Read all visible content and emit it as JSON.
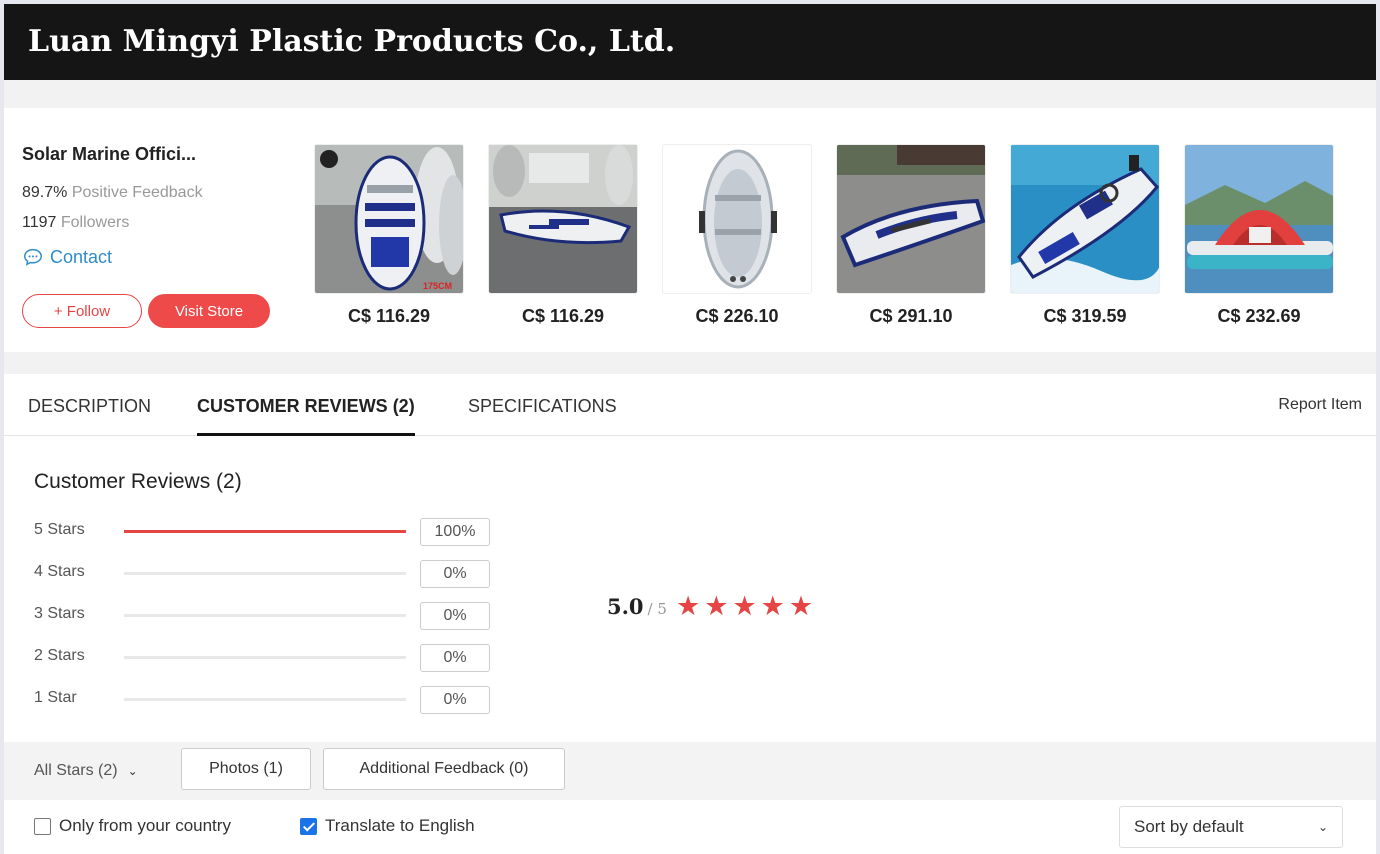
{
  "header": {
    "company_name": "Luan Mingyi Plastic Products Co., Ltd."
  },
  "store": {
    "name": "Solar Marine Offici...",
    "feedback_value": "89.7%",
    "feedback_label": "Positive Feedback",
    "followers_value": "1197",
    "followers_label": "Followers",
    "contact_label": "Contact",
    "follow_label": "+ Follow",
    "visit_label": "Visit Store"
  },
  "products": [
    {
      "price": "C$ 116.29",
      "image": "inflatable-boat-warehouse",
      "badge": "175CM"
    },
    {
      "price": "C$ 116.29",
      "image": "inflatable-boat-floor"
    },
    {
      "price": "C$ 226.10",
      "image": "inflatable-boat-top-view"
    },
    {
      "price": "C$ 291.10",
      "image": "inflatable-boat-pavement"
    },
    {
      "price": "C$ 319.59",
      "image": "inflatable-boat-on-water"
    },
    {
      "price": "C$ 232.69",
      "image": "inflatable-platform-tent"
    }
  ],
  "tabs": {
    "description": "DESCRIPTION",
    "reviews": "CUSTOMER REVIEWS (2)",
    "specifications": "SPECIFICATIONS",
    "active": "reviews"
  },
  "report_label": "Report Item",
  "reviews": {
    "title": "Customer Reviews (2)",
    "distribution": [
      {
        "label": "5 Stars",
        "percent": "100%",
        "fraction": 1.0
      },
      {
        "label": "4 Stars",
        "percent": "0%",
        "fraction": 0
      },
      {
        "label": "3 Stars",
        "percent": "0%",
        "fraction": 0
      },
      {
        "label": "2 Stars",
        "percent": "0%",
        "fraction": 0
      },
      {
        "label": "1 Star",
        "percent": "0%",
        "fraction": 0
      }
    ],
    "average": "5.0",
    "average_total": "/ 5",
    "star_rating": 5
  },
  "filters": {
    "all_stars": "All Stars (2)",
    "photos": "Photos (1)",
    "additional": "Additional Feedback (0)"
  },
  "options": {
    "only_country_label": "Only from your country",
    "only_country_checked": false,
    "translate_label": "Translate to English",
    "translate_checked": true,
    "sort_label": "Sort by default"
  },
  "colors": {
    "accent": "#e64545",
    "link": "#2f8ccc",
    "checkbox": "#1a73e8",
    "header_bg": "#151515"
  }
}
